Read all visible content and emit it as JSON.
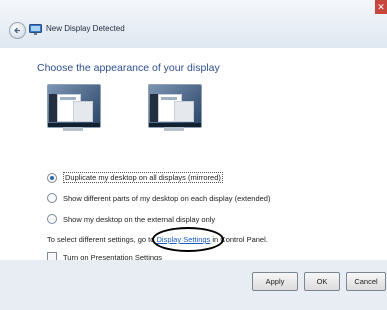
{
  "window": {
    "title": "New Display Detected",
    "close_glyph": "✕",
    "back_icon": "back-arrow-icon",
    "app_icon": "display-settings-icon"
  },
  "main": {
    "heading": "Choose the appearance of your display",
    "options": [
      {
        "label": "Duplicate my desktop on all displays (mirrored)",
        "selected": true
      },
      {
        "label": "Show different parts of my desktop on each display (extended)",
        "selected": false
      },
      {
        "label": "Show my desktop on the external display only",
        "selected": false
      }
    ],
    "settings_prefix": "To select different settings, go to ",
    "settings_link": "Display Settings",
    "settings_suffix": " in Control Panel.",
    "presentation_label": "Turn on Presentation Settings"
  },
  "buttons": {
    "apply": "Apply",
    "ok": "OK",
    "cancel": "Cancel"
  },
  "colors": {
    "heading": "#2e4f8f",
    "link": "#1a5bc4",
    "close": "#c8473c"
  }
}
